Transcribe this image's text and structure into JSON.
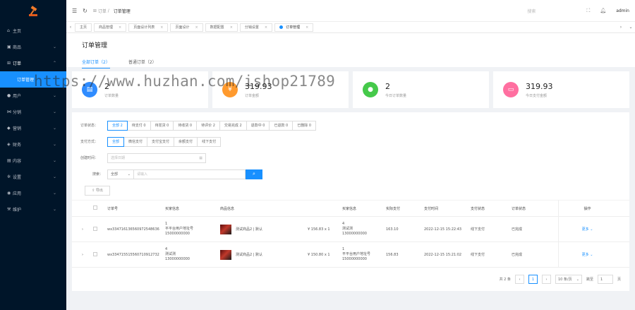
{
  "sidebar": {
    "items": [
      {
        "icon": "home-icon",
        "label": "主页"
      },
      {
        "icon": "goods-icon",
        "label": "商品"
      },
      {
        "icon": "cart-icon",
        "label": "订单"
      },
      {
        "label": "订单管理"
      },
      {
        "icon": "user-icon",
        "label": "用户"
      },
      {
        "icon": "share-icon",
        "label": "分销"
      },
      {
        "icon": "promo-icon",
        "label": "营销"
      },
      {
        "icon": "finance-icon",
        "label": "财务"
      },
      {
        "icon": "content-icon",
        "label": "内容"
      },
      {
        "icon": "settings-icon",
        "label": "设置"
      },
      {
        "icon": "app-icon",
        "label": "应用"
      },
      {
        "icon": "maintain-icon",
        "label": "维护"
      }
    ]
  },
  "topbar": {
    "crumb_parent": "订单",
    "crumb_current": "订单管理",
    "search_placeholder": "搜索",
    "user": "admin"
  },
  "tabs": [
    "主页",
    "商品管理",
    "页面设计列表",
    "页面设计",
    "数据配置",
    "分销设置",
    "订单管理"
  ],
  "page": {
    "title": "订单管理",
    "subtabs": [
      "全部订单（2）",
      "普通订单（2）"
    ]
  },
  "cards": [
    {
      "value": "2",
      "label": "订单数量",
      "color": "#2f8cff",
      "icon": "order-icon"
    },
    {
      "value": "319.93",
      "label": "订单金额",
      "color": "#ff9a2e",
      "icon": "money-icon"
    },
    {
      "value": "2",
      "label": "今日订单数量",
      "color": "#45c94a",
      "icon": "chat-icon"
    },
    {
      "value": "319.93",
      "label": "今日支付金额",
      "color": "#ff6fa0",
      "icon": "wallet-icon"
    }
  ],
  "filters": {
    "status_label": "订单状态：",
    "status_opts": [
      "全部 2",
      "待支付 0",
      "待发货 0",
      "待收货 0",
      "待评价 2",
      "交易完成 2",
      "退款中 0",
      "已退款 0",
      "已删除 0"
    ],
    "pay_label": "支付方式：",
    "pay_opts": [
      "全部",
      "微信支付",
      "支付宝支付",
      "余额支付",
      "线下支付"
    ],
    "date_label": "创建时间：",
    "date_placeholder": "选择日期",
    "search_label": "搜索：",
    "search_select": "全部",
    "search_placeholder": "请输入",
    "export": "导出"
  },
  "table": {
    "headers": [
      "订单号",
      "买家信息",
      "商品信息",
      "",
      "买家信息",
      "实际支付",
      "支付时间",
      "支付状态",
      "订单状态",
      "操作"
    ],
    "rows": [
      {
        "order": "wx334716136560972548636",
        "buyer1": "1",
        "buyer2": "平平台用户地址号",
        "buyer3": "15000000000",
        "product": "测试商品2 | 默认",
        "price": "¥ 156.83 x 1",
        "b1": "4",
        "b2": "测试测",
        "b3": "13000000000",
        "paid": "163.10",
        "time": "2022-12-15 15:22:43",
        "pay": "线下支付",
        "state": "已完成",
        "op": "更多"
      },
      {
        "order": "wx334715515560710912732",
        "buyer1": "4",
        "buyer2": "测试测",
        "buyer3": "13000000000",
        "product": "测试商品2 | 默认",
        "price": "¥ 150.80 x 1",
        "b1": "1",
        "b2": "平平台用户地址号",
        "b3": "15000000000",
        "paid": "156.83",
        "time": "2022-12-15 15:21:02",
        "pay": "线下支付",
        "state": "已完成",
        "op": "更多"
      }
    ]
  },
  "pagination": {
    "total": "共 2 条",
    "page": "1",
    "size": "10 条/页",
    "goto": "跳至",
    "goto_val": "1",
    "unit": "页"
  },
  "watermark": "https://www.huzhan.com/ishop21789"
}
